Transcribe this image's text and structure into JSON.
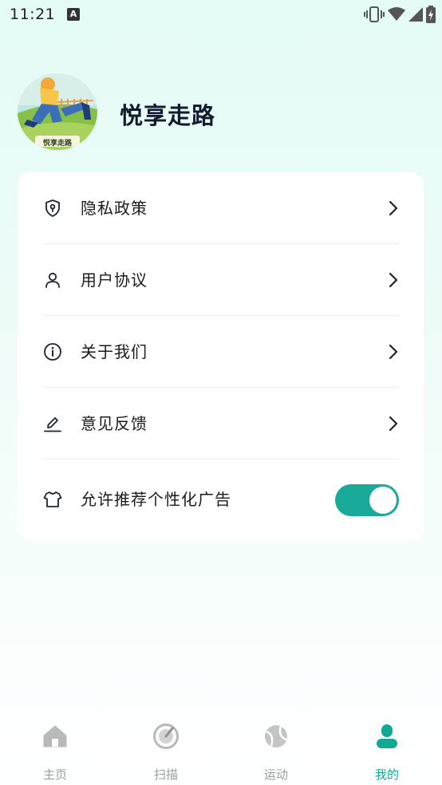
{
  "status_bar": {
    "time": "11:21",
    "notification_badge": "A"
  },
  "profile": {
    "name": "悦享走路",
    "avatar_caption": "悦享走路"
  },
  "menu": [
    {
      "label": "隐私政策",
      "icon": "shield-icon"
    },
    {
      "label": "用户协议",
      "icon": "user-icon"
    },
    {
      "label": "关于我们",
      "icon": "info-icon"
    },
    {
      "label": "意见反馈",
      "icon": "pen-icon"
    }
  ],
  "ad_setting": {
    "label": "允许推荐个性化广告",
    "icon": "shirt-icon",
    "enabled": true
  },
  "bottom_nav": [
    {
      "label": "主页",
      "icon": "home-icon",
      "active": false
    },
    {
      "label": "扫描",
      "icon": "scan-icon",
      "active": false
    },
    {
      "label": "运动",
      "icon": "sport-ball-icon",
      "active": false
    },
    {
      "label": "我的",
      "icon": "profile-icon",
      "active": true
    }
  ],
  "colors": {
    "accent": "#13a896",
    "toggle_on": "#1aaa99",
    "icon_dark": "#1b2230",
    "inactive": "#9a9a9a"
  }
}
